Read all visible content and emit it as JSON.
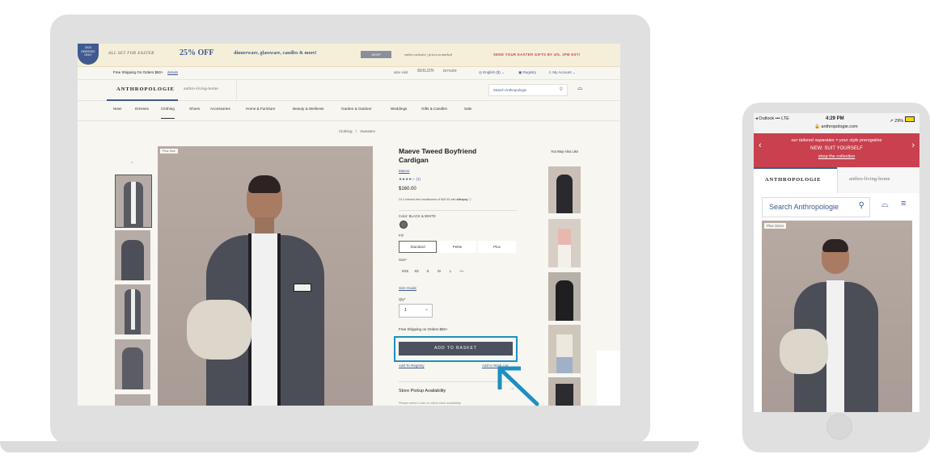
{
  "desktop": {
    "promo": {
      "badge": [
        "2023",
        "DRESSES",
        "ONLY"
      ],
      "all_set": "ALL SET FOR EASTER",
      "discount": "25% OFF",
      "discount_items": "dinnerware, glassware, candles & more!",
      "shop": "SHOP",
      "online_exclusive": "online exclusive | prices as marked",
      "send_gifts": "SEND YOUR EASTER GIFTS BY 4/5, 1PM EST!"
    },
    "utility": {
      "free_shipping": "Free Shipping On Orders $50+",
      "details": "details",
      "also_visit": "also visit",
      "beldn": "BHLDN",
      "terrain": "terrain",
      "language": "English ($)",
      "registry": "Registry",
      "my_account": "My Account"
    },
    "logo": "ANTHROPOLOGIE",
    "living_logo": "anthro-living-home",
    "search_placeholder": "Search Anthropologie",
    "nav": [
      "New!",
      "Dresses",
      "Clothing",
      "Shoes",
      "Accessories",
      "Home & Furniture",
      "Beauty & Wellness",
      "Garden & Outdoor",
      "Weddings",
      "Gifts & Candles",
      "Sale"
    ],
    "breadcrumb": [
      "Clothing",
      "/",
      "Sweaters"
    ],
    "plus_size_tag": "Plus Size",
    "product": {
      "title_line1": "Maeve Tweed Boyfriend",
      "title_line2": "Cardigan",
      "brand": "Maeve",
      "stars": "★★★★☆",
      "review_count": "(1)",
      "price": "$160.00",
      "installments": "Or 4 interest-free installments of $40.00 with",
      "afterpay": "afterpay",
      "color_label": "Color: BLACK & WHITE",
      "fit_label": "Fit*",
      "fits": [
        "Standard",
        "Petite",
        "Plus"
      ],
      "size_label": "Size*",
      "sizes": [
        "XXS",
        "XS",
        "S",
        "M",
        "L",
        "XL"
      ],
      "size_guide": "Size Guide",
      "qty_label": "Qty*",
      "qty_value": "1",
      "shipping_note": "Free Shipping on Orders $50+",
      "add_to_basket": "ADD TO BASKET",
      "add_to_registry": "Add To Registry",
      "add_to_wishlist": "Add to Wish List",
      "store_pickup": "Store Pickup Availability",
      "store_pickup_note": "Please select a size to check store availability."
    },
    "you_may_also_like": "You May Also Like"
  },
  "mobile": {
    "status": {
      "carrier": "◂ Outlook",
      "network": "LTE",
      "time": "4:29 PM",
      "battery": "29%",
      "url": "anthropologie.com"
    },
    "banner": {
      "line1": "our tailored separates = your style prerogative",
      "line2": "NEW: SUIT YOURSELF",
      "link": "shop the collection"
    },
    "tab_logo": "ANTHROPOLOGIE",
    "tab_living": "anthro-living-home",
    "search_placeholder": "Search Anthropologie",
    "plus_size_tag": "Plus Sizes"
  },
  "colors": {
    "highlight": "#1e8fc0",
    "banner_red": "#c9404e",
    "button_dark": "#4c5160"
  }
}
